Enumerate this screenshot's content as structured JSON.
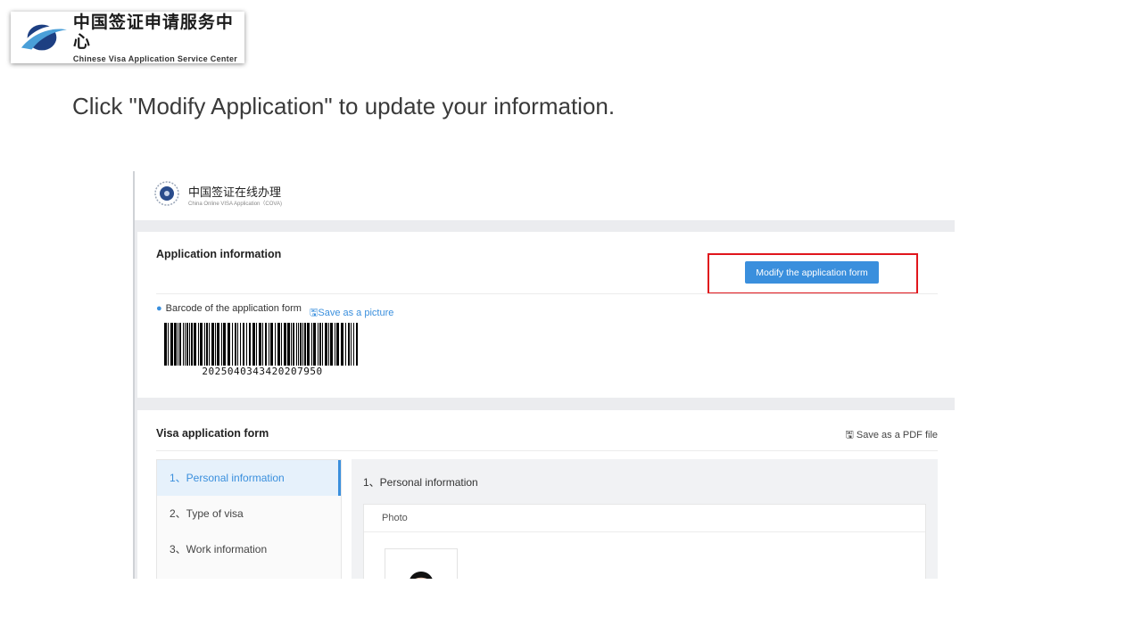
{
  "logo": {
    "cn": "中国签证申请服务中心",
    "en": "Chinese Visa Application Service Center"
  },
  "instruction": "Click \"Modify Application\" to update your information.",
  "site": {
    "title": "中国签证在线办理",
    "subtitle": "China Online VISA Application（COVA)"
  },
  "application_info": {
    "title": "Application information",
    "modify_button": "Modify the application form",
    "barcode_label": "Barcode of the application form",
    "save_picture": "Save as a picture",
    "barcode_number": "2025040343420207950"
  },
  "visa_form": {
    "title": "Visa application form",
    "save_pdf": "Save as a PDF file",
    "nav": [
      {
        "label": "1、Personal information",
        "active": true
      },
      {
        "label": "2、Type of visa",
        "active": false
      },
      {
        "label": "3、Work information",
        "active": false
      }
    ],
    "section_title": "1、Personal information",
    "photo_label": "Photo"
  },
  "colors": {
    "accent": "#3a8fdd",
    "highlight": "#e0161c"
  }
}
